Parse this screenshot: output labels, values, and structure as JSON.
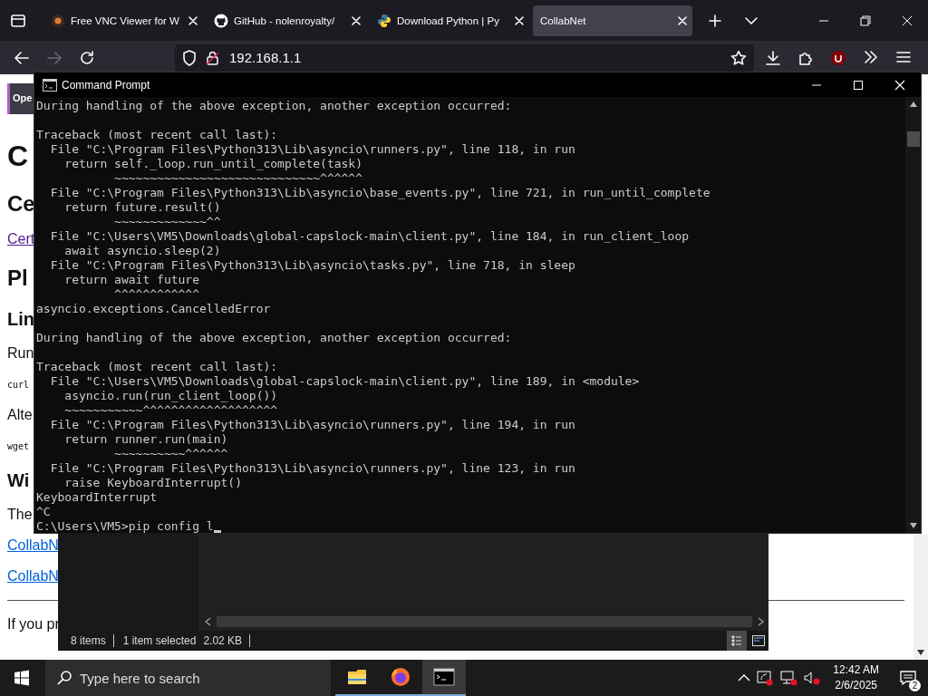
{
  "browser": {
    "tabs": [
      {
        "label": "Free VNC Viewer for W",
        "selected": false
      },
      {
        "label": "GitHub - nolenroyalty/",
        "selected": false
      },
      {
        "label": "Download Python | Py",
        "selected": false
      },
      {
        "label": "CollabNet",
        "selected": true
      }
    ],
    "forward_enabled": false,
    "address": "192.168.1.1",
    "page": [
      {
        "kind": "button",
        "text": "Ope"
      },
      {
        "kind": "h1",
        "text": "C"
      },
      {
        "kind": "h2",
        "text": "Ce"
      },
      {
        "kind": "link",
        "text": "Cert",
        "visited": true
      },
      {
        "kind": "h2",
        "text": "Pl"
      },
      {
        "kind": "h3",
        "text": "Lin"
      },
      {
        "kind": "p",
        "text": "Run"
      },
      {
        "kind": "code",
        "text": "curl"
      },
      {
        "kind": "p",
        "text": "Alte"
      },
      {
        "kind": "code",
        "text": "wget"
      },
      {
        "kind": "h3",
        "text": "Wi"
      },
      {
        "kind": "p",
        "text": "The"
      },
      {
        "kind": "link",
        "text": "CollabN",
        "visited": false
      },
      {
        "kind": "link",
        "text": "CollabN",
        "visited": false
      },
      {
        "kind": "rule"
      },
      {
        "kind": "p",
        "text": "If you pr"
      }
    ]
  },
  "console": {
    "title": "Command Prompt",
    "cursor": true,
    "blocks": [
      [
        "During handling of the above exception, another exception occurred:"
      ],
      [
        "Traceback (most recent call last):",
        "  File \"C:\\Program Files\\Python313\\Lib\\asyncio\\runners.py\", line 118, in run",
        "    return self._loop.run_until_complete(task)",
        "           ~~~~~~~~~~~~~~~~~~~~~~~~~~~~~^^^^^^",
        "  File \"C:\\Program Files\\Python313\\Lib\\asyncio\\base_events.py\", line 721, in run_until_complete",
        "    return future.result()",
        "           ~~~~~~~~~~~~~^^",
        "  File \"C:\\Users\\VM5\\Downloads\\global-capslock-main\\client.py\", line 184, in run_client_loop",
        "    await asyncio.sleep(2)",
        "  File \"C:\\Program Files\\Python313\\Lib\\asyncio\\tasks.py\", line 718, in sleep",
        "    return await future",
        "           ^^^^^^^^^^^^",
        "asyncio.exceptions.CancelledError"
      ],
      [
        "During handling of the above exception, another exception occurred:"
      ],
      [
        "Traceback (most recent call last):",
        "  File \"C:\\Users\\VM5\\Downloads\\global-capslock-main\\client.py\", line 189, in <module>",
        "    asyncio.run(run_client_loop())",
        "    ~~~~~~~~~~~^^^^^^^^^^^^^^^^^^^",
        "  File \"C:\\Program Files\\Python313\\Lib\\asyncio\\runners.py\", line 194, in run",
        "    return runner.run(main)",
        "           ~~~~~~~~~~^^^^^^",
        "  File \"C:\\Program Files\\Python313\\Lib\\asyncio\\runners.py\", line 123, in run",
        "    raise KeyboardInterrupt()",
        "KeyboardInterrupt",
        "^C",
        "C:\\Users\\VM5>pip config l"
      ]
    ]
  },
  "explorer": {
    "status": [
      "8 items",
      "1 item selected",
      "2.02 KB"
    ],
    "views": [
      {
        "selected": true
      },
      {
        "selected": false
      }
    ]
  },
  "taskbar": {
    "search_placeholder": "Type here to search",
    "apps": [
      {
        "running": true,
        "selected": false
      },
      {
        "running": true,
        "selected": false
      },
      {
        "running": true,
        "selected": true
      }
    ],
    "time": "12:42 AM",
    "date": "2/6/2025",
    "notifications": "2"
  }
}
